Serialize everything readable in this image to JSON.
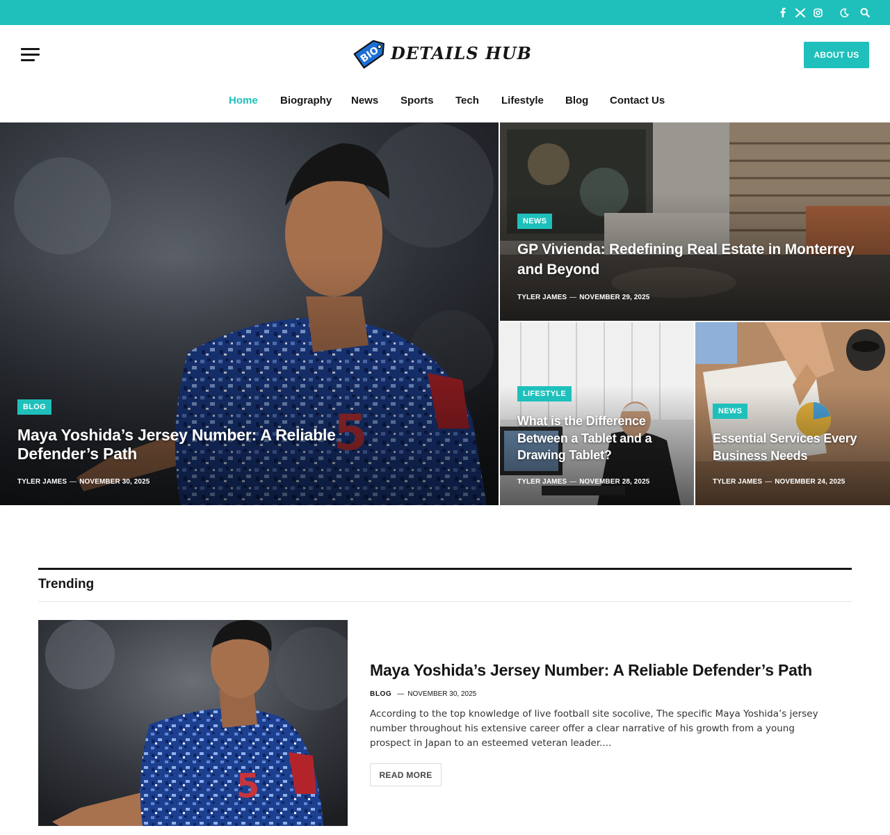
{
  "topbar": {
    "accent_color": "#1fc0bb",
    "icons": [
      "facebook-icon",
      "x-icon",
      "instagram-icon",
      "dark-mode-icon",
      "search-icon"
    ]
  },
  "header": {
    "logo_badge": "BIO",
    "logo_text": "DETAILS HUB",
    "about_label": "ABOUT US"
  },
  "nav": {
    "items": [
      {
        "label": "Home",
        "active": true
      },
      {
        "label": "Biography",
        "active": false
      },
      {
        "label": "News",
        "active": false
      },
      {
        "label": "Sports",
        "active": false
      },
      {
        "label": "Tech",
        "active": false
      },
      {
        "label": "Lifestyle",
        "active": false
      },
      {
        "label": "Blog",
        "active": false
      },
      {
        "label": "Contact Us",
        "active": false
      }
    ]
  },
  "featured": [
    {
      "category": "BLOG",
      "title": "Maya Yoshida’s Jersey Number: A Reliable Defender’s Path",
      "author": "TYLER JAMES",
      "date": "NOVEMBER 30, 2025"
    },
    {
      "category": "NEWS",
      "title": "GP Vivienda: Redefining Real Estate in Monterrey and Beyond",
      "author": "TYLER JAMES",
      "date": "NOVEMBER 29, 2025"
    },
    {
      "category": "LIFESTYLE",
      "title": "What is the Difference Between a Tablet and a Drawing Tablet?",
      "author": "TYLER JAMES",
      "date": "NOVEMBER 28, 2025"
    },
    {
      "category": "NEWS",
      "title": "Essential Services Every Business Needs",
      "author": "TYLER JAMES",
      "date": "NOVEMBER 24, 2025"
    }
  ],
  "trending": {
    "heading": "Trending",
    "post": {
      "title": "Maya Yoshida’s Jersey Number: A Reliable Defender’s Path",
      "category": "BLOG",
      "date": "NOVEMBER 30, 2025",
      "excerpt": "According to the top knowledge of live football site socolive, The specific Maya Yoshida’s jersey number throughout his extensive career offer a clear narrative of his growth from a young prospect in Japan to an esteemed veteran leader....",
      "read_more": "READ MORE"
    }
  }
}
